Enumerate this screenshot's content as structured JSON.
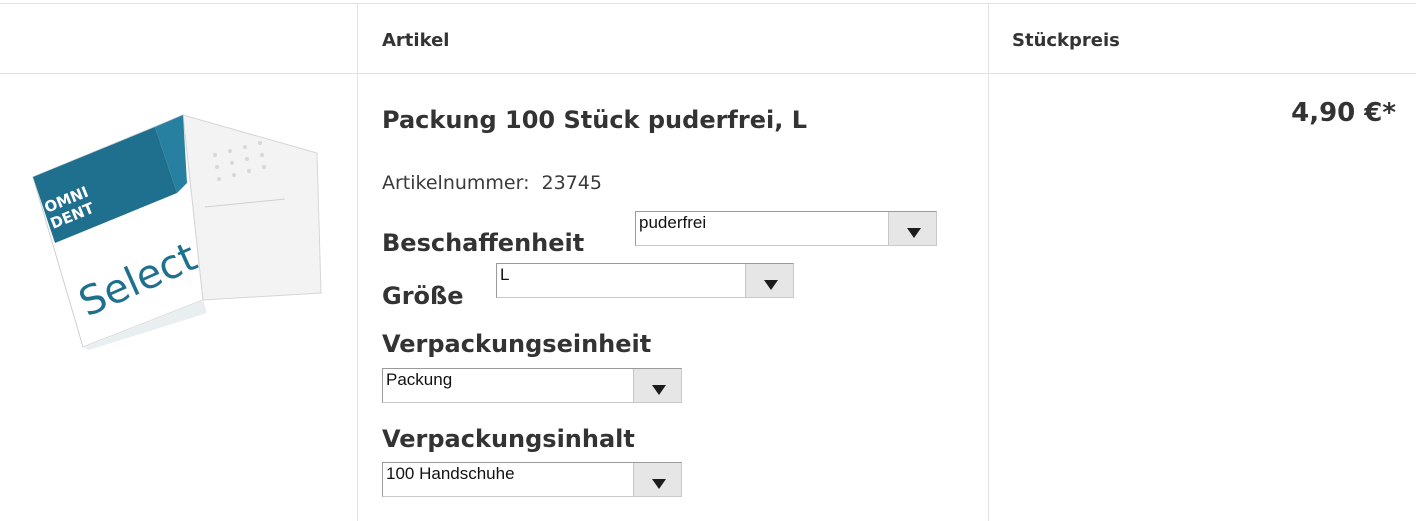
{
  "table": {
    "headers": {
      "article": "Artikel",
      "unit_price": "Stückpreis"
    }
  },
  "product": {
    "image_brand_top": "OMNI",
    "image_brand_bottom": "DENT",
    "image_product_name": "Select",
    "title": "Packung 100 Stück puderfrei, L",
    "article_number_label": "Artikelnummer:",
    "article_number": "23745",
    "price": "4,90 €*"
  },
  "options": {
    "texture": {
      "label": "Beschaffenheit",
      "value": "puderfrei"
    },
    "size": {
      "label": "Größe",
      "value": "L"
    },
    "packaging_unit": {
      "label": "Verpackungseinheit",
      "value": "Packung"
    },
    "packaging_content": {
      "label": "Verpackungsinhalt",
      "value": "100 Handschuhe"
    }
  },
  "colors": {
    "grid": "#e1e1e1",
    "box_blue": "#1f6f8f",
    "text": "#333333"
  }
}
